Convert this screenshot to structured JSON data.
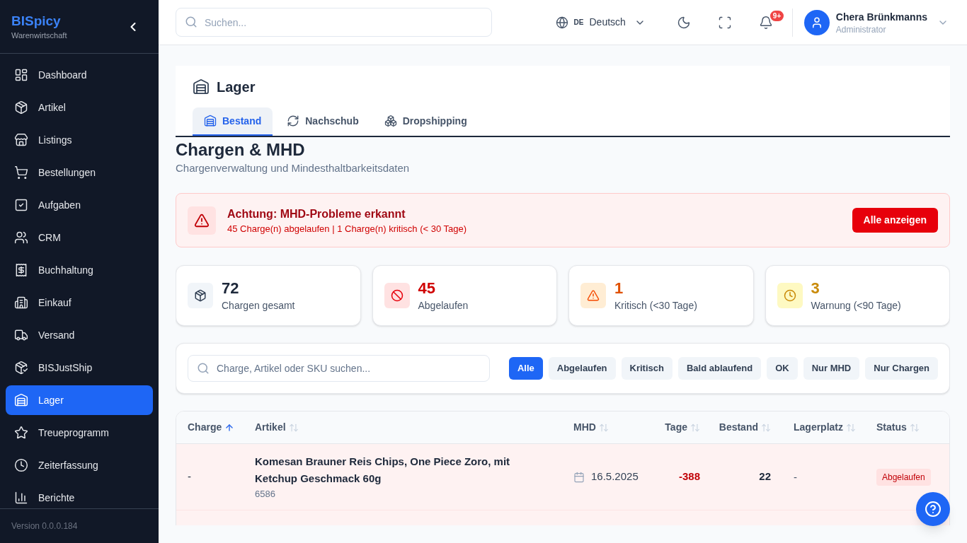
{
  "sidebar": {
    "brand": "BISpicy",
    "subtitle": "Warenwirtschaft",
    "items": [
      {
        "label": "Dashboard",
        "selected": false
      },
      {
        "label": "Artikel",
        "selected": false
      },
      {
        "label": "Listings",
        "selected": false
      },
      {
        "label": "Bestellungen",
        "selected": false
      },
      {
        "label": "Aufgaben",
        "selected": false
      },
      {
        "label": "CRM",
        "selected": false
      },
      {
        "label": "Buchhaltung",
        "selected": false
      },
      {
        "label": "Einkauf",
        "selected": false
      },
      {
        "label": "Versand",
        "selected": false
      },
      {
        "label": "BISJustShip",
        "selected": false
      },
      {
        "label": "Lager",
        "selected": true
      },
      {
        "label": "Treueprogramm",
        "selected": false
      },
      {
        "label": "Zeiterfassung",
        "selected": false
      },
      {
        "label": "Berichte",
        "selected": false
      }
    ],
    "version": "Version 0.0.0.184"
  },
  "topbar": {
    "search": {
      "placeholder": "Suchen..."
    },
    "language": {
      "code": "DE",
      "label": "Deutsch"
    },
    "notifications": {
      "badge": "9+"
    },
    "user": {
      "name": "Chera Brünkmanns",
      "role": "Administrator"
    }
  },
  "page": {
    "title": "Lager",
    "tabs": [
      {
        "label": "Bestand",
        "selected": true
      },
      {
        "label": "Nachschub",
        "selected": false
      },
      {
        "label": "Dropshipping",
        "selected": false
      }
    ]
  },
  "section": {
    "title": "Chargen & MHD",
    "subtitle": "Chargenverwaltung und Mindesthaltbarkeitsdaten"
  },
  "alert": {
    "title": "Achtung: MHD-Probleme erkannt",
    "message": "45 Charge(n) abgelaufen | 1 Charge(n) kritisch (< 30 Tage)",
    "button": "Alle anzeigen"
  },
  "stats": [
    {
      "kind": "total",
      "value": "72",
      "label": "Chargen gesamt"
    },
    {
      "kind": "expired",
      "value": "45",
      "label": "Abgelaufen"
    },
    {
      "kind": "critical",
      "value": "1",
      "label": "Kritisch (<30 Tage)"
    },
    {
      "kind": "warning",
      "value": "3",
      "label": "Warnung (<90 Tage)"
    }
  ],
  "filters": {
    "search": {
      "placeholder": "Charge, Artikel oder SKU suchen..."
    },
    "chips": [
      {
        "label": "Alle",
        "selected": true
      },
      {
        "label": "Abgelaufen",
        "selected": false
      },
      {
        "label": "Kritisch",
        "selected": false
      },
      {
        "label": "Bald ablaufend",
        "selected": false
      },
      {
        "label": "OK",
        "selected": false
      },
      {
        "label": "Nur MHD",
        "selected": false
      },
      {
        "label": "Nur Chargen",
        "selected": false
      }
    ]
  },
  "table": {
    "columns": [
      {
        "label": "Charge",
        "sorted": true
      },
      {
        "label": "Artikel",
        "sorted": false
      },
      {
        "label": "MHD",
        "sorted": false
      },
      {
        "label": "Tage",
        "sorted": false
      },
      {
        "label": "Bestand",
        "sorted": false
      },
      {
        "label": "Lagerplatz",
        "sorted": false
      },
      {
        "label": "Status",
        "sorted": false
      }
    ],
    "rows": [
      {
        "kind": "expired",
        "charge": "-",
        "article": "Komesan Brauner Reis Chips, One Piece Zoro, mit Ketchup Geschmack 60g",
        "sku": "6586",
        "mhd": "16.5.2025",
        "days": "-388",
        "stock": "22",
        "location": "-",
        "status": "Abgelaufen"
      },
      {
        "kind": "expired"
      }
    ]
  }
}
